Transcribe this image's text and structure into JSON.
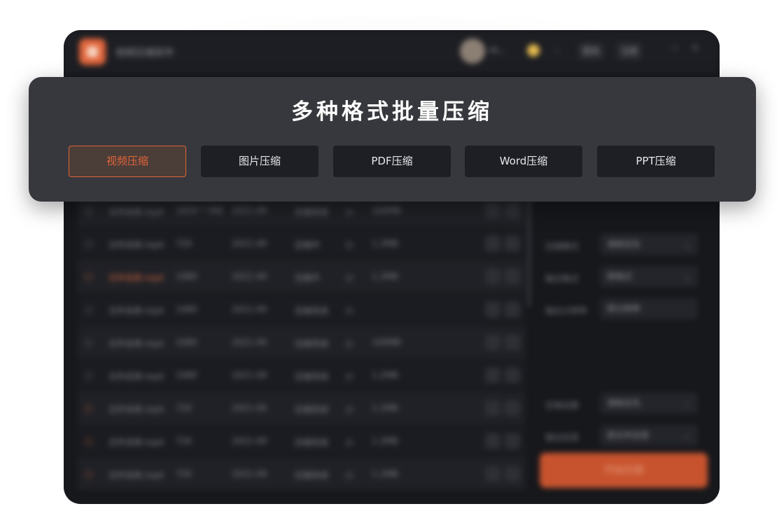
{
  "app": {
    "title": "视频压缩软件",
    "user_name": "Hi...",
    "top_buttons": [
      "登陆",
      "注册"
    ],
    "window_controls": [
      "—",
      "✕"
    ],
    "start_button_label": "开始压缩"
  },
  "table_rows": [
    {
      "name": "文件名称.mp4",
      "c2": "1024 * 768",
      "c3": "2021-09",
      "c4": "压缩完成",
      "c5": "小",
      "c6": "100MB"
    },
    {
      "name": "文件名称.mp4",
      "c2": "720",
      "c3": "2021-09",
      "c4": "压缩中",
      "c5": "小",
      "c6": "1.2MB"
    },
    {
      "name": "文件名称.mp4",
      "c2": "1080",
      "c3": "2021-09",
      "c4": "压缩中",
      "c5": "小",
      "c6": "1.2MB"
    },
    {
      "name": "文件名称.mp4",
      "c2": "1080",
      "c3": "2021-09",
      "c4": "压缩完成",
      "c5": "小",
      "c6": ""
    },
    {
      "name": "文件名称.mp4",
      "c2": "1080",
      "c3": "2021-09",
      "c4": "压缩完成",
      "c5": "小",
      "c6": "100MB"
    },
    {
      "name": "文件名称.mp4",
      "c2": "1080",
      "c3": "2021-09",
      "c4": "压缩完成",
      "c5": "小",
      "c6": "1.2MB"
    },
    {
      "name": "文件名称.mp4",
      "c2": "720",
      "c3": "2021-09",
      "c4": "压缩完成",
      "c5": "小",
      "c6": "1.2MB"
    },
    {
      "name": "文件名称.mp4",
      "c2": "720",
      "c3": "2021-09",
      "c4": "压缩完成",
      "c5": "小",
      "c6": "1.2MB"
    },
    {
      "name": "文件名称.mp4",
      "c2": "720",
      "c3": "2021-09",
      "c4": "压缩完成",
      "c5": "小",
      "c6": "1.2MB"
    }
  ],
  "side_panel": {
    "fields": [
      {
        "label": "压缩模式",
        "value": "清晰优先"
      },
      {
        "label": "输出格式",
        "value": "原格式"
      },
      {
        "label": "输出分辨率",
        "value": "原分辨率"
      },
      {
        "label": "压缩设置",
        "value": "清晰优先"
      },
      {
        "label": "输出目录",
        "value": "原文件目录"
      }
    ]
  },
  "overlay": {
    "title": "多种格式批量压缩",
    "tabs": [
      {
        "label": "视频压缩",
        "active": true
      },
      {
        "label": "图片压缩",
        "active": false
      },
      {
        "label": "PDF压缩",
        "active": false
      },
      {
        "label": "Word压缩",
        "active": false
      },
      {
        "label": "PPT压缩",
        "active": false
      }
    ]
  },
  "colors": {
    "accent": "#e0653b",
    "overlay_bg": "#37383d",
    "app_bg": "#17181c",
    "tab_bg": "#1e1f24"
  }
}
